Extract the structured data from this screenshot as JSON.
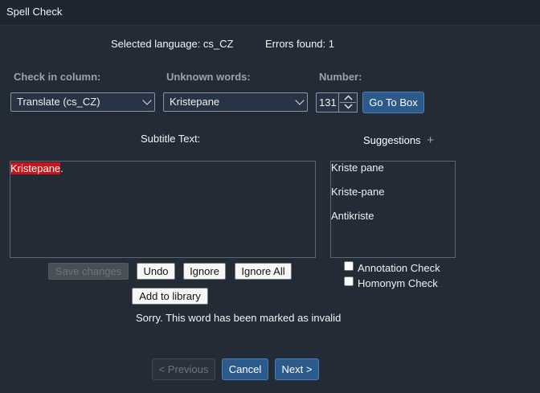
{
  "window": {
    "title": "Spell Check"
  },
  "status": {
    "selected_language": "Selected language: cs_CZ",
    "errors_found": "Errors found: 1"
  },
  "headers": {
    "check_in_column": "Check in column:",
    "unknown_words": "Unknown words:",
    "number": "Number:"
  },
  "controls": {
    "column_select": "Translate (cs_CZ)",
    "word_select": "Kristepane",
    "number_value": "131",
    "goto_label": "Go To Box"
  },
  "subtitle": {
    "label": "Subtitle Text:",
    "error_word": "Kristepane",
    "trailing": "."
  },
  "suggestions": {
    "label": "Suggestions",
    "add_symbol": "+",
    "items": [
      "Kriste pane",
      "Kriste-pane",
      "Antikriste"
    ]
  },
  "actions": {
    "save_changes": "Save changes",
    "undo": "Undo",
    "ignore": "Ignore",
    "ignore_all": "Ignore All",
    "add_to_library": "Add to library"
  },
  "checks": {
    "annotation": "Annotation Check",
    "homonym": "Homonym Check"
  },
  "message": "Sorry. This word has been marked as invalid",
  "nav": {
    "previous": "< Previous",
    "cancel": "Cancel",
    "next": "Next >"
  },
  "colors": {
    "background": "#222b36",
    "accent_blue": "#2c5a8a",
    "error_highlight": "#c4161c"
  }
}
